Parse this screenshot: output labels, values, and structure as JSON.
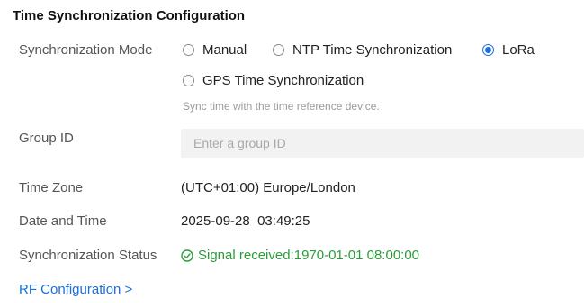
{
  "title": "Time Synchronization Configuration",
  "sync_mode": {
    "label": "Synchronization Mode",
    "options": [
      "Manual",
      "NTP Time Synchronization",
      "LoRa",
      "GPS Time Synchronization"
    ],
    "selected": "LoRa",
    "hint": "Sync time with the time reference device."
  },
  "group_id": {
    "label": "Group ID",
    "value": "",
    "placeholder": "Enter a group ID"
  },
  "time_zone": {
    "label": "Time Zone",
    "value": "(UTC+01:00) Europe/London"
  },
  "date_time": {
    "label": "Date and Time",
    "value": "2025-09-28  03:49:25"
  },
  "sync_status": {
    "label": "Synchronization Status",
    "value": "Signal received:1970-01-01 08:00:00",
    "icon": "check-circle-icon",
    "color": "#2a9d3a"
  },
  "rf_link": "RF Configuration >",
  "colors": {
    "accent": "#1a6fdc",
    "success": "#2a9d3a"
  }
}
